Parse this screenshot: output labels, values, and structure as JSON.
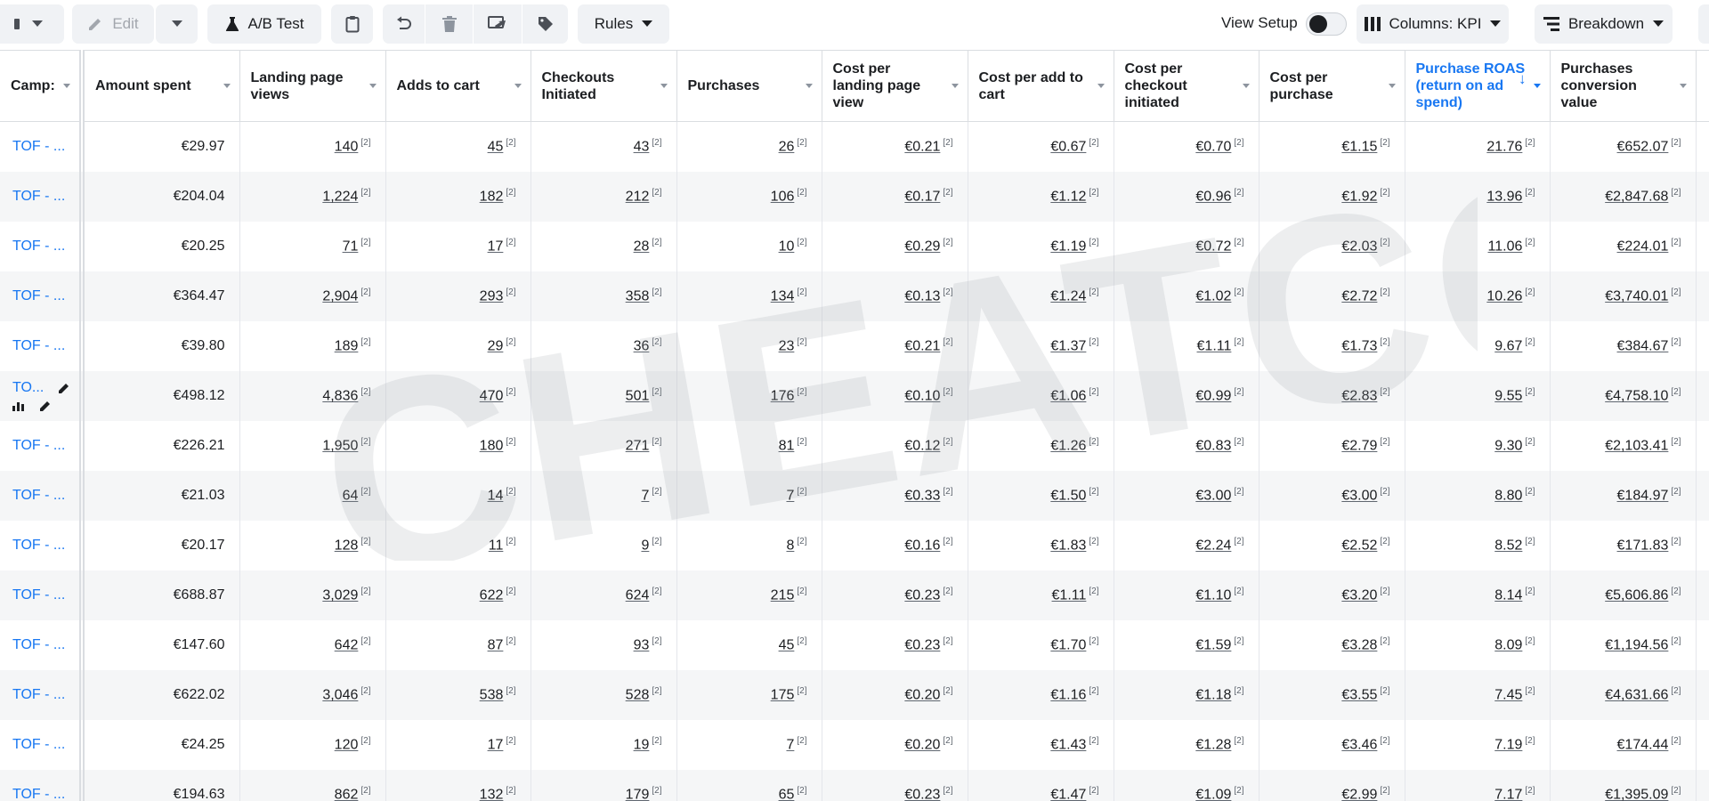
{
  "toolbar": {
    "edit_label": "Edit",
    "ab_test_label": "A/B Test",
    "rules_label": "Rules",
    "view_setup_label": "View Setup",
    "columns_label": "Columns: KPI",
    "breakdown_label": "Breakdown"
  },
  "watermark": {
    "text": "CHEATCOD"
  },
  "table": {
    "columns": [
      "Camp:",
      "Amount spent",
      "Landing page views",
      "Adds to cart",
      "Checkouts Initiated",
      "Purchases",
      "Cost per landing page view",
      "Cost per add to cart",
      "Cost per checkout initiated",
      "Cost per purchase",
      "Purchase ROAS (return on ad spend)",
      "Purchases conversion value"
    ],
    "sort_arrow": "↓",
    "footnote": "[2]",
    "rows": [
      [
        "TOF - ...",
        "€29.97",
        "140",
        "45",
        "43",
        "26",
        "€0.21",
        "€0.67",
        "€0.70",
        "€1.15",
        "21.76",
        "€652.07"
      ],
      [
        "TOF - ...",
        "€204.04",
        "1,224",
        "182",
        "212",
        "106",
        "€0.17",
        "€1.12",
        "€0.96",
        "€1.92",
        "13.96",
        "€2,847.68"
      ],
      [
        "TOF - ...",
        "€20.25",
        "71",
        "17",
        "28",
        "10",
        "€0.29",
        "€1.19",
        "€0.72",
        "€2.03",
        "11.06",
        "€224.01"
      ],
      [
        "TOF - ...",
        "€364.47",
        "2,904",
        "293",
        "358",
        "134",
        "€0.13",
        "€1.24",
        "€1.02",
        "€2.72",
        "10.26",
        "€3,740.01"
      ],
      [
        "TOF - ...",
        "€39.80",
        "189",
        "29",
        "36",
        "23",
        "€0.21",
        "€1.37",
        "€1.11",
        "€1.73",
        "9.67",
        "€384.67"
      ],
      [
        "TO...",
        "€498.12",
        "4,836",
        "470",
        "501",
        "176",
        "€0.10",
        "€1.06",
        "€0.99",
        "€2.83",
        "9.55",
        "€4,758.10"
      ],
      [
        "TOF - ...",
        "€226.21",
        "1,950",
        "180",
        "271",
        "81",
        "€0.12",
        "€1.26",
        "€0.83",
        "€2.79",
        "9.30",
        "€2,103.41"
      ],
      [
        "TOF - ...",
        "€21.03",
        "64",
        "14",
        "7",
        "7",
        "€0.33",
        "€1.50",
        "€3.00",
        "€3.00",
        "8.80",
        "€184.97"
      ],
      [
        "TOF - ...",
        "€20.17",
        "128",
        "11",
        "9",
        "8",
        "€0.16",
        "€1.83",
        "€2.24",
        "€2.52",
        "8.52",
        "€171.83"
      ],
      [
        "TOF - ...",
        "€688.87",
        "3,029",
        "622",
        "624",
        "215",
        "€0.23",
        "€1.11",
        "€1.10",
        "€3.20",
        "8.14",
        "€5,606.86"
      ],
      [
        "TOF - ...",
        "€147.60",
        "642",
        "87",
        "93",
        "45",
        "€0.23",
        "€1.70",
        "€1.59",
        "€3.28",
        "8.09",
        "€1,194.56"
      ],
      [
        "TOF - ...",
        "€622.02",
        "3,046",
        "538",
        "528",
        "175",
        "€0.20",
        "€1.16",
        "€1.18",
        "€3.55",
        "7.45",
        "€4,631.66"
      ],
      [
        "TOF - ...",
        "€24.25",
        "120",
        "17",
        "19",
        "7",
        "€0.20",
        "€1.43",
        "€1.28",
        "€3.46",
        "7.19",
        "€174.44"
      ],
      [
        "TOF - ...",
        "€194.63",
        "862",
        "132",
        "179",
        "65",
        "€0.23",
        "€1.47",
        "€1.09",
        "€2.99",
        "7.17",
        "€1,395.09"
      ]
    ]
  },
  "colors": {
    "accent": "#1877f2",
    "button_bg": "#f0f2f5",
    "row_alt": "#f5f6f7"
  }
}
